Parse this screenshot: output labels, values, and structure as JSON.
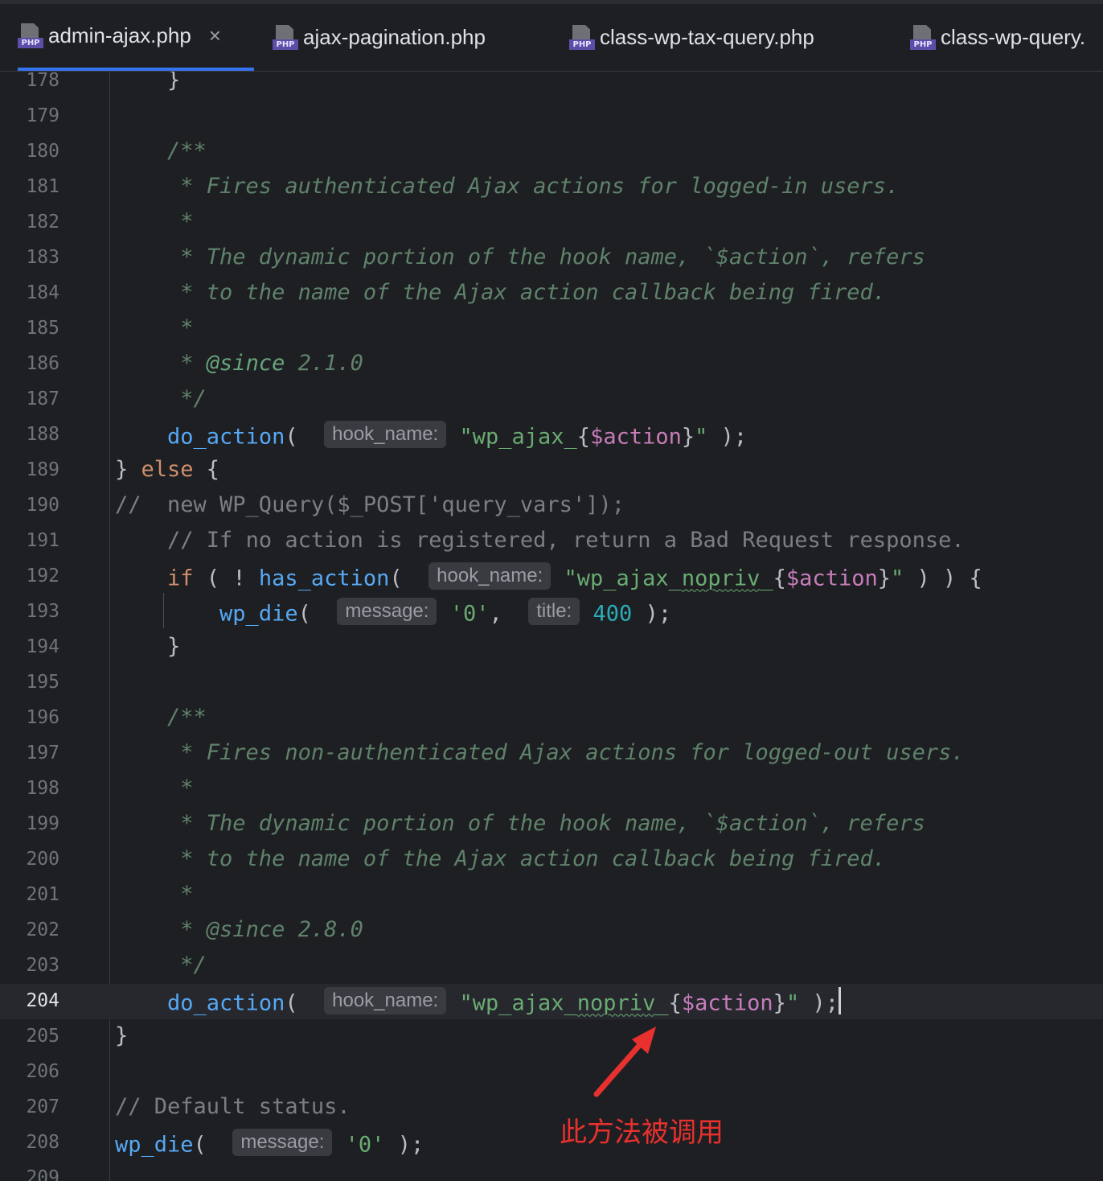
{
  "tabs": [
    {
      "label": "admin-ajax.php",
      "icon": "php-file-icon",
      "active": true,
      "closable": true
    },
    {
      "label": "ajax-pagination.php",
      "icon": "php-file-icon",
      "active": false
    },
    {
      "label": "class-wp-tax-query.php",
      "icon": "php-file-icon",
      "active": false
    },
    {
      "label": "class-wp-query.",
      "icon": "php-file-icon",
      "active": false
    }
  ],
  "tab_close_glyph": "×",
  "php_icon_text": "PHP",
  "line_numbers": [
    "178",
    "179",
    "180",
    "181",
    "182",
    "183",
    "184",
    "185",
    "186",
    "187",
    "188",
    "189",
    "190",
    "191",
    "192",
    "193",
    "194",
    "195",
    "196",
    "197",
    "198",
    "199",
    "200",
    "201",
    "202",
    "203",
    "204",
    "205",
    "206",
    "207",
    "208",
    "209"
  ],
  "current_line": "204",
  "code": {
    "l178": "    }",
    "l180": "    /**",
    "l181": "     * Fires authenticated Ajax actions for logged-in users.",
    "l182": "     *",
    "l183": "     * The dynamic portion of the hook name, `$action`, refers",
    "l184": "     * to the name of the Ajax action callback being fired.",
    "l185": "     *",
    "l186_star": "     * ",
    "l186_tag": "@since",
    "l186_ver": " 2.1.0",
    "l187": "     */",
    "l188_fn": "do_action",
    "l188_hint": "hook_name:",
    "l188_str1": "\"wp_ajax_",
    "l188_var": "$action",
    "l189_else": "else",
    "l190": "//  new WP_Query($_POST['query_vars']);",
    "l191": "// If no action is registered, return a Bad Request response.",
    "l192_kw": "if",
    "l192_fn": "has_action",
    "l192_hint": "hook_name:",
    "l192_str1": "\"wp_ajax_",
    "l192_sq": "nopriv",
    "l192_str2": "_",
    "l192_var": "$action",
    "l193_fn": "wp_die",
    "l193_hint1": "message:",
    "l193_str": "'0'",
    "l193_hint2": "title:",
    "l193_num": "400",
    "l196": "    /**",
    "l197": "     * Fires non-authenticated Ajax actions for logged-out users.",
    "l198": "     *",
    "l199": "     * The dynamic portion of the hook name, `$action`, refers",
    "l200": "     * to the name of the Ajax action callback being fired.",
    "l201": "     *",
    "l202_tag": "@since",
    "l202_ver": " 2.8.0",
    "l203": "     */",
    "l204_fn": "do_action",
    "l204_hint": "hook_name:",
    "l204_str1": "\"wp_ajax_",
    "l204_sq": "nopriv",
    "l204_str2": "_",
    "l204_var": "$action",
    "l207": "// Default status.",
    "l208_fn": "wp_die",
    "l208_hint": "message:",
    "l208_str": "'0'"
  },
  "annotation": {
    "text": "此方法被调用",
    "color": "#e8312f"
  },
  "colors": {
    "background": "#1e1f22",
    "comment_doc": "#5f826b",
    "function": "#56a8f5",
    "keyword": "#cf8e6d",
    "string": "#6aab73",
    "variable": "#c77dbb",
    "number": "#2aacb8",
    "active_tab_underline": "#3574f0"
  }
}
